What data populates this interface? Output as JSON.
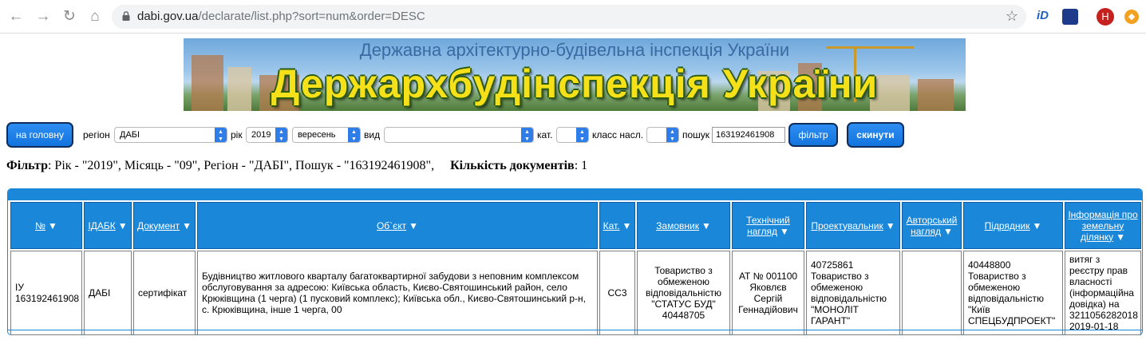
{
  "browser": {
    "url_host": "dabi.gov.ua",
    "url_path": "/declarate/list.php?sort=num&order=DESC",
    "profile_initial": "Н",
    "extension_1": "iD"
  },
  "banner": {
    "subtitle": "Державна архітектурно-будівельна інспекція України",
    "title": "Держархбудінспекція України"
  },
  "filters": {
    "home_button": "на головну",
    "region_label": "регіон",
    "region_value": "ДАБІ",
    "year_label": "рік",
    "year_value": "2019",
    "month_value": "вересень",
    "type_label": "вид",
    "type_value": "",
    "cat_label": "кат.",
    "cat_value": "",
    "class_label": "класс насл.",
    "class_value": "",
    "search_label": "пошук",
    "search_value": "163192461908",
    "filter_button": "фільтр",
    "reset_button": "скинути"
  },
  "filter_summary": {
    "filter_label": "Фільтр",
    "filter_text": ": Рік - \"2019\", Місяць - \"09\", Регіон - \"ДАБІ\", Пошук - \"163192461908\",",
    "count_label": "Кількість документів",
    "count_text": ": 1"
  },
  "table": {
    "headers": [
      "№",
      "ІДАБК",
      "Документ",
      "Об`єкт",
      "Кат.",
      "Замовник",
      "Технічний нагляд",
      "Проектувальник",
      "Авторський нагляд",
      "Підрядник",
      "Інформація про земельну ділянку"
    ],
    "sort_arrow": "▼",
    "rows": [
      {
        "num": "ІУ 163192461908",
        "idabk": "ДАБІ",
        "document": "сертифікат",
        "object": "Будівництво житлового кварталу багатоквартирної забудови з неповним комплексом обслуговування за адресою: Київська область, Києво-Святошинський район, село Крюківщина (1 черга) (1 пусковий комплекс); Київська обл., Києво-Святошинський р-н, с. Крюківщина, інше 1 черга, 00",
        "category": "СС3",
        "customer": "Товариство з обмеженою відповідальністю \"СТАТУС БУД\" 40448705",
        "tech_supervision": "АТ № 001100 Яковлєв Сергій Геннадійович",
        "designer": "40725861 Товариство з обмеженою відповідальністю \"МОНОЛІТ ГАРАНТ\"",
        "author_supervision": "",
        "contractor": "40448800 Товариство з обмеженою відповідальністю \"Київ СПЕЦБУДПРОЕКТ\"",
        "land_info": "витяг з реєстру прав власності (інформаційна довідка) на 3211056282018 2019-01-18"
      }
    ]
  }
}
